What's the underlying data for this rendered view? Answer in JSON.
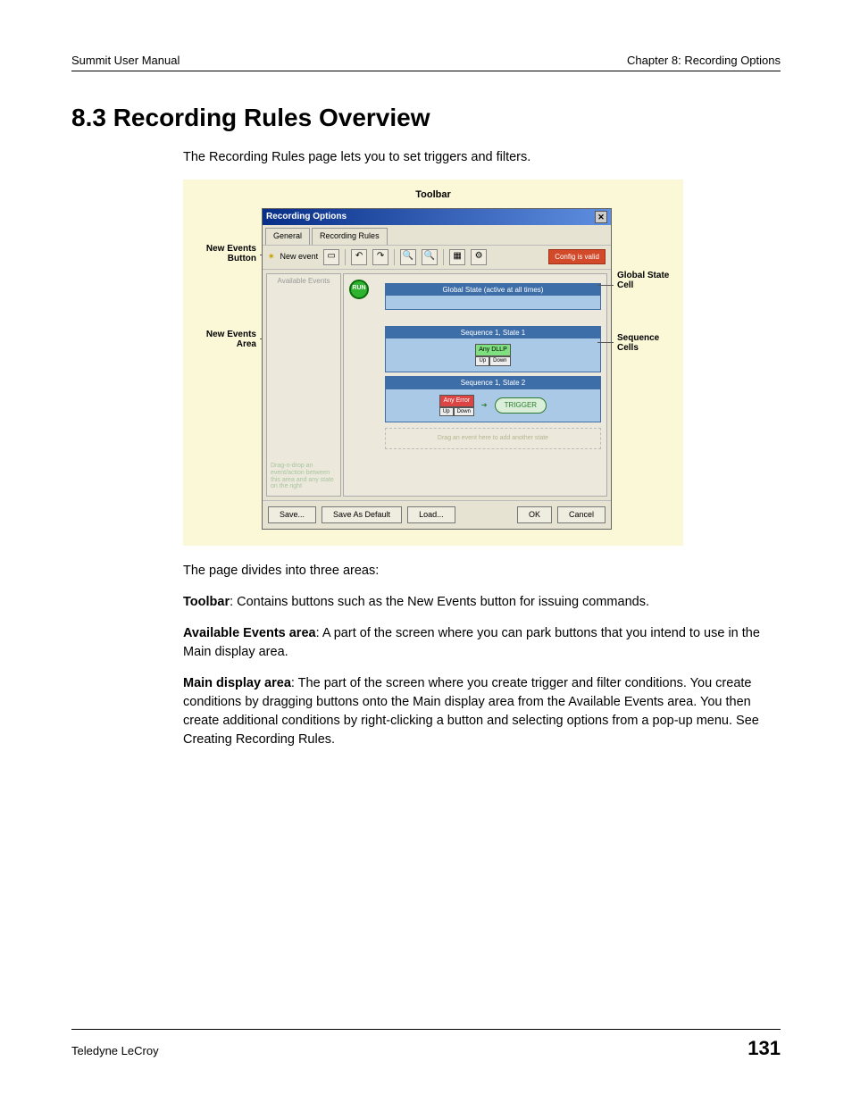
{
  "header": {
    "left": "Summit User Manual",
    "right": "Chapter 8: Recording Options"
  },
  "section": {
    "title": "8.3 Recording Rules Overview"
  },
  "intro": "The Recording Rules page lets you to set triggers and filters.",
  "figure": {
    "top_label": "Toolbar",
    "left_labels": {
      "new_events_button": "New Events Button",
      "new_events_area": "New Events Area"
    },
    "right_labels": {
      "global_state_cell": "Global State Cell",
      "sequence_cells": "Sequence Cells"
    },
    "dialog": {
      "title": "Recording Options",
      "tabs": {
        "general": "General",
        "recording_rules": "Recording Rules"
      },
      "toolbar": {
        "new_event": "New event",
        "valid": "Config is valid"
      },
      "available_events": "Available Events",
      "events_hint": "Drag-n-drop an event/action between this area and any state on the right",
      "run": "RUN",
      "global_state_bar": "Global State (active at all times)",
      "seq1_bar": "Sequence 1, State 1",
      "seq2_bar": "Sequence 1, State 2",
      "chip_dllp": "Any DLLP",
      "chip_error": "Any Error",
      "chip_up": "Up",
      "chip_down": "Down",
      "trigger": "TRIGGER",
      "drag_hint": "Drag an event here to add another state",
      "buttons": {
        "save": "Save...",
        "save_default": "Save As Default",
        "load": "Load...",
        "ok": "OK",
        "cancel": "Cancel"
      }
    }
  },
  "para_divides": "The page divides into three areas:",
  "para_toolbar_label": "Toolbar",
  "para_toolbar_rest": ": Contains buttons such as the New Events button for issuing commands.",
  "para_avail_label": "Available Events area",
  "para_avail_rest": ": A part of the screen where you can park buttons that you intend to use in the Main display area.",
  "para_main_label": "Main display area",
  "para_main_rest": ": The part of the screen where you create trigger and filter conditions. You create conditions by dragging buttons onto the Main display area from the Available Events area. You then create additional conditions by right-clicking a button and selecting options from a pop-up menu. See Creating Recording Rules.",
  "footer": {
    "brand_strong": "Teledyne",
    "brand_rest": " LeCroy",
    "page": "131"
  }
}
